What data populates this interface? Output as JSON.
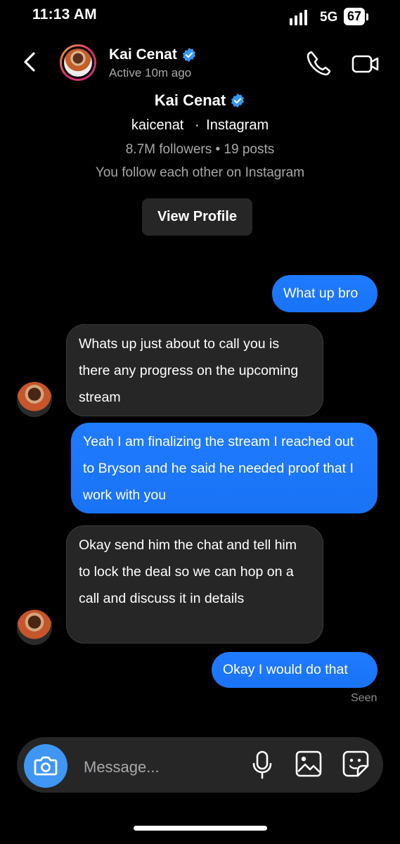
{
  "status_bar": {
    "time": "11:13 AM",
    "network": "5G",
    "battery": "67"
  },
  "header": {
    "name": "Kai Cenat",
    "status": "Active 10m ago",
    "icons": [
      "back-arrow-icon",
      "verified-badge-icon",
      "phone-icon",
      "video-camera-icon"
    ]
  },
  "profile": {
    "name": "Kai Cenat",
    "username": "kaicenat",
    "platform": "Instagram",
    "separator": "·",
    "stats": "8.7M followers • 19 posts",
    "mutual": "You follow each other on Instagram",
    "view_profile_label": "View Profile"
  },
  "messages": [
    {
      "direction": "sent",
      "text": "What up bro"
    },
    {
      "direction": "received",
      "text": "Whats up just about to call you is there any progress on the upcoming stream"
    },
    {
      "direction": "sent",
      "text": "Yeah I am finalizing the stream I reached out to Bryson and he said he needed proof that I work with you"
    },
    {
      "direction": "received",
      "text": "Okay send him the chat and tell him to lock the deal so we can hop on a call and discuss it in details"
    },
    {
      "direction": "sent",
      "text": "Okay I would do that"
    }
  ],
  "seen_label": "Seen",
  "composer": {
    "placeholder": "Message...",
    "icons": [
      "camera-icon",
      "microphone-icon",
      "gallery-icon",
      "sticker-icon"
    ]
  },
  "colors": {
    "background": "#000000",
    "sent_bubble": "#1f7bff",
    "received_bubble": "#262626",
    "secondary_text": "#a8a8a8",
    "verified": "#3797f0"
  }
}
